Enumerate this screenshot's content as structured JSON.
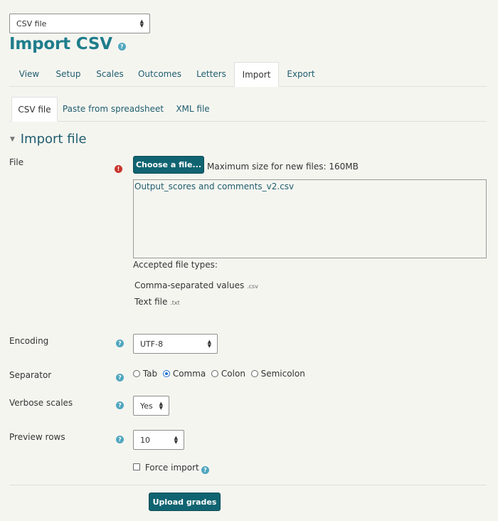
{
  "top_select": {
    "value": "CSV file"
  },
  "page": {
    "title": "Import CSV"
  },
  "main_tabs": [
    {
      "label": "View"
    },
    {
      "label": "Setup"
    },
    {
      "label": "Scales"
    },
    {
      "label": "Outcomes"
    },
    {
      "label": "Letters"
    },
    {
      "label": "Import"
    },
    {
      "label": "Export"
    }
  ],
  "sub_tabs": [
    {
      "label": "CSV file"
    },
    {
      "label": "Paste from spreadsheet"
    },
    {
      "label": "XML file"
    }
  ],
  "section": {
    "title": "Import file"
  },
  "file": {
    "label": "File",
    "choose_button": "Choose a file...",
    "max_size": "Maximum size for new files: 160MB",
    "uploaded_name": "Output_scores and comments_v2.csv",
    "accepted_label": "Accepted file types:",
    "types": [
      {
        "name": "Comma-separated values",
        "ext": ".csv"
      },
      {
        "name": "Text file",
        "ext": ".txt"
      }
    ]
  },
  "encoding": {
    "label": "Encoding",
    "value": "UTF-8"
  },
  "separator": {
    "label": "Separator",
    "options": [
      "Tab",
      "Comma",
      "Colon",
      "Semicolon"
    ],
    "selected": "Comma"
  },
  "verbose": {
    "label": "Verbose scales",
    "value": "Yes"
  },
  "preview": {
    "label": "Preview rows",
    "value": "10"
  },
  "force": {
    "label": "Force import",
    "checked": false
  },
  "submit": {
    "label": "Upload grades"
  },
  "colors": {
    "accent": "#1f7d8c",
    "button": "#106471",
    "error": "#c9342b",
    "help": "#4fa6bf"
  }
}
